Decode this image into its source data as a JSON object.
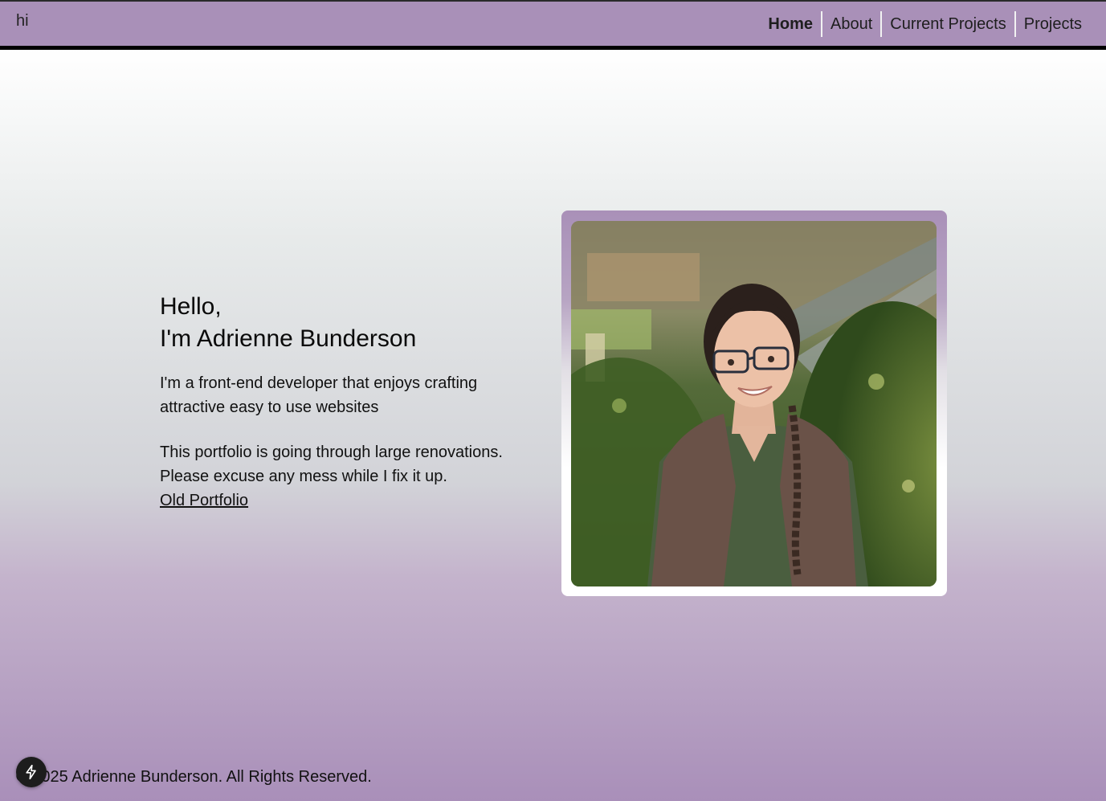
{
  "header": {
    "brand": "hi",
    "nav": [
      {
        "label": "Home",
        "active": true
      },
      {
        "label": "About"
      },
      {
        "label": "Current Projects"
      },
      {
        "label": "Projects"
      }
    ]
  },
  "intro": {
    "greeting_line1": "Hello,",
    "greeting_line2": "I'm Adrienne Bunderson",
    "paragraph1": "I'm a front-end developer that enjoys crafting attractive easy to use websites",
    "paragraph2": "This portfolio is going through large renovations. Please excuse any mess while I fix it up.",
    "old_portfolio_link": "Old Portfolio"
  },
  "footer": {
    "copyright": "© 2025 Adrienne Bunderson. All Rights Reserved."
  },
  "icons": {
    "dev_badge": "lightning-bolt-icon"
  },
  "colors": {
    "accent": "#a990b8",
    "nav_border": "#000000"
  }
}
